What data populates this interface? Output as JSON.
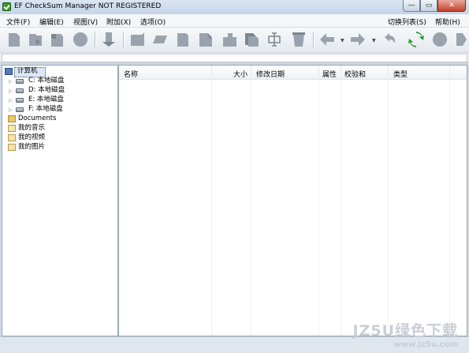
{
  "window": {
    "title": "EF CheckSum Manager NOT REGISTERED",
    "min_glyph": "—",
    "max_glyph": "▭",
    "close_glyph": "✕"
  },
  "menu": {
    "left": [
      "文件(F)",
      "编辑(E)",
      "视图(V)",
      "附加(X)",
      "选项(O)"
    ],
    "right": [
      "切换列表(S)",
      "帮助(H)"
    ]
  },
  "toolbar": {
    "icons": [
      "new-checksum-icon",
      "open-icon",
      "refresh-file-icon",
      "circle-icon",
      "import-icon",
      "create-icon",
      "parallelogram-icon",
      "verify-icon",
      "edit-icon",
      "puzzle-icon",
      "copy-icon",
      "rename-icon",
      "delete-icon",
      "back-arrow-icon",
      "forward-arrow-icon",
      "undo-icon",
      "refresh-icon",
      "stop-icon",
      "exit-icon"
    ],
    "accent_color": "#9aa3ad",
    "refresh_color": "#2f9a2f"
  },
  "tree": {
    "items": [
      {
        "label": "计算机",
        "icon": "computer-icon"
      },
      {
        "label": "C: 本地磁盘",
        "icon": "drive-icon"
      },
      {
        "label": "D: 本地磁盘",
        "icon": "drive-icon"
      },
      {
        "label": "E: 本地磁盘",
        "icon": "drive-icon"
      },
      {
        "label": "F: 本地磁盘",
        "icon": "drive-icon"
      },
      {
        "label": "Documents",
        "icon": "folder-icon"
      },
      {
        "label": "我的音乐",
        "icon": "music-folder-icon"
      },
      {
        "label": "我的视频",
        "icon": "video-folder-icon"
      },
      {
        "label": "我的图片",
        "icon": "picture-folder-icon"
      }
    ]
  },
  "list": {
    "columns": [
      "名称",
      "大小",
      "修改日期",
      "属性",
      "校验和",
      "类型"
    ]
  },
  "watermark": {
    "big": "JZ5U绿色下载",
    "small": "www.jz5u.com"
  }
}
